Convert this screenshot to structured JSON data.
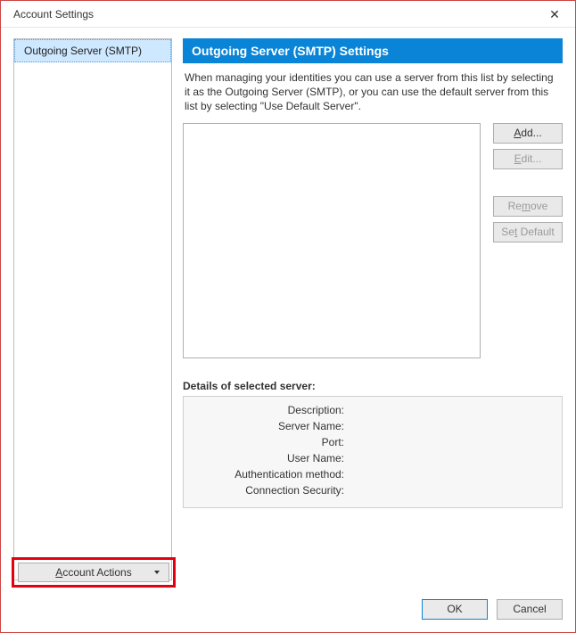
{
  "window": {
    "title": "Account Settings"
  },
  "sidebar": {
    "items": [
      {
        "label": "Outgoing Server (SMTP)"
      }
    ],
    "account_actions_label": "Account Actions"
  },
  "main": {
    "header": "Outgoing Server (SMTP) Settings",
    "intro": "When managing your identities you can use a server from this list by selecting it as the Outgoing Server (SMTP), or you can use the default server from this list by selecting \"Use Default Server\".",
    "buttons": {
      "add": "Add...",
      "edit": "Edit...",
      "remove": "Remove",
      "set_default": "Set Default"
    },
    "details_heading": "Details of selected server:",
    "details": {
      "description_label": "Description:",
      "description_value": "",
      "server_name_label": "Server Name:",
      "server_name_value": "",
      "port_label": "Port:",
      "port_value": "",
      "user_name_label": "User Name:",
      "user_name_value": "",
      "auth_label": "Authentication method:",
      "auth_value": "",
      "conn_label": "Connection Security:",
      "conn_value": ""
    }
  },
  "footer": {
    "ok": "OK",
    "cancel": "Cancel"
  }
}
